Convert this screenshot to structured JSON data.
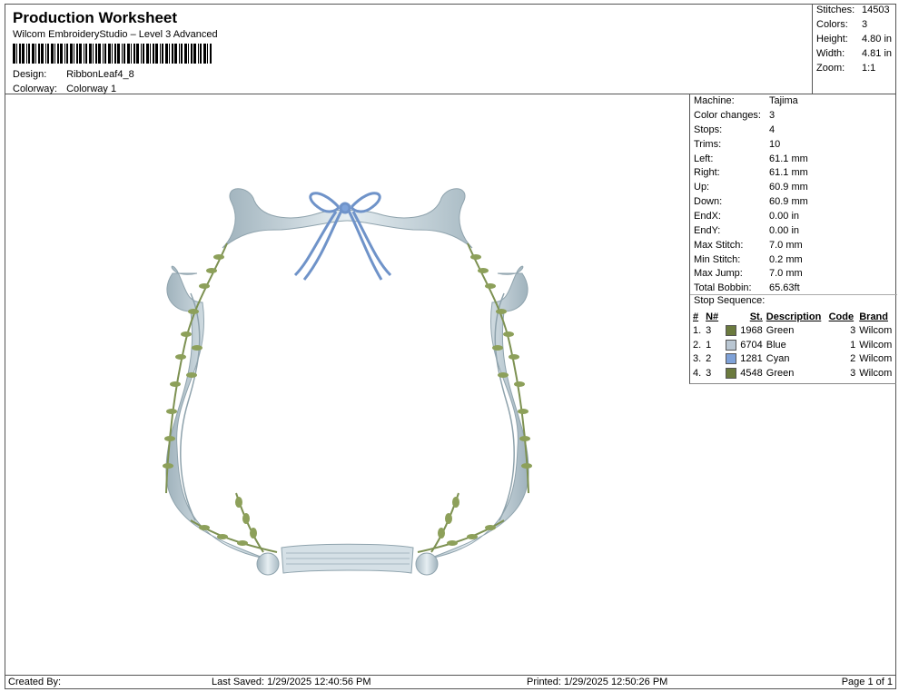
{
  "header": {
    "title": "Production Worksheet",
    "subtitle": "Wilcom EmbroideryStudio – Level 3 Advanced",
    "design_label": "Design:",
    "design_value": "RibbonLeaf4_8",
    "colorway_label": "Colorway:",
    "colorway_value": "Colorway 1"
  },
  "stats": [
    {
      "label": "Stitches:",
      "value": "14503"
    },
    {
      "label": "Colors:",
      "value": "3"
    },
    {
      "label": "Height:",
      "value": "4.80 in"
    },
    {
      "label": "Width:",
      "value": "4.81 in"
    },
    {
      "label": "Zoom:",
      "value": "1:1"
    }
  ],
  "machine_info": [
    {
      "label": "Machine:",
      "value": "Tajima"
    },
    {
      "label": "Color changes:",
      "value": "3"
    },
    {
      "label": "Stops:",
      "value": "4"
    },
    {
      "label": "Trims:",
      "value": "10"
    },
    {
      "label": "Left:",
      "value": "61.1 mm"
    },
    {
      "label": "Right:",
      "value": "61.1 mm"
    },
    {
      "label": "Up:",
      "value": "60.9 mm"
    },
    {
      "label": "Down:",
      "value": "60.9 mm"
    },
    {
      "label": "EndX:",
      "value": "0.00 in"
    },
    {
      "label": "EndY:",
      "value": "0.00 in"
    },
    {
      "label": "Max Stitch:",
      "value": "7.0 mm"
    },
    {
      "label": "Min Stitch:",
      "value": "0.2 mm"
    },
    {
      "label": "Max Jump:",
      "value": "7.0 mm"
    },
    {
      "label": "Total Bobbin:",
      "value": "65.63ft"
    }
  ],
  "stop_sequence": {
    "label": "Stop Sequence:",
    "headers": [
      "#",
      "N#",
      "St.",
      "Description",
      "Code",
      "Brand"
    ],
    "rows": [
      {
        "idx": "1.",
        "n": "3",
        "color": "#6b7a3e",
        "st": "1968",
        "desc": "Green",
        "code": "3",
        "brand": "Wilcom"
      },
      {
        "idx": "2.",
        "n": "1",
        "color": "#b9c6d2",
        "st": "6704",
        "desc": "Blue",
        "code": "1",
        "brand": "Wilcom"
      },
      {
        "idx": "3.",
        "n": "2",
        "color": "#7fa2d8",
        "st": "1281",
        "desc": "Cyan",
        "code": "2",
        "brand": "Wilcom"
      },
      {
        "idx": "4.",
        "n": "3",
        "color": "#6b7a3e",
        "st": "4548",
        "desc": "Green",
        "code": "3",
        "brand": "Wilcom"
      }
    ]
  },
  "footer": {
    "created": "Created By:",
    "saved": "Last Saved: 1/29/2025 12:40:56 PM",
    "printed": "Printed: 1/29/2025 12:50:26 PM",
    "page": "Page 1 of 1"
  },
  "colors": {
    "leaf_green": "#7d9152",
    "frame_blue": "#c4d2da",
    "bow_blue": "#7ea3da"
  }
}
